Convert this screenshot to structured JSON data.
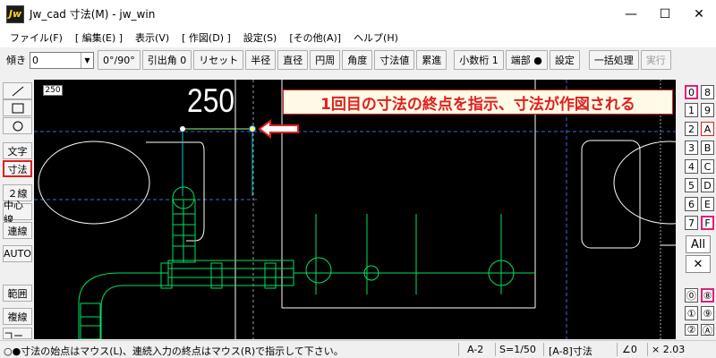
{
  "window": {
    "app_icon": "Jw",
    "title": "Jw_cad 寸法(M) - jw_win",
    "minimize": "—",
    "maximize": "☐",
    "close": "✕"
  },
  "menu": [
    "ファイル(F)",
    "[ 編集(E) ]",
    "表示(V)",
    "[ 作図(D) ]",
    "設定(S)",
    "[その他(A)]",
    "ヘルプ(H)"
  ],
  "toolbar": {
    "tilt_label": "傾き",
    "tilt_value": "0",
    "buttons": {
      "angle": "0°/90°",
      "leader": "引出角 0",
      "reset": "リセット",
      "radius": "半径",
      "diameter": "直径",
      "circumference": "円周",
      "angle_dim": "角度",
      "dim_value": "寸法値",
      "cumulative": "累進",
      "decimal": "小数桁 1",
      "end": "端部 ●",
      "settings": "設定",
      "batch": "一括処理",
      "execute": "実行"
    }
  },
  "left_tools": {
    "line": "line-tool-icon",
    "rect": "rectangle-tool-icon",
    "circle": "circle-tool-icon",
    "text": "文字",
    "dimension": "寸法",
    "double_line": "２線",
    "center_line": "中心線",
    "continuous_line": "連線",
    "auto": "AUTO",
    "range": "範囲",
    "copy_line": "複線",
    "corner": "コーナー"
  },
  "canvas": {
    "scale_tag": "250",
    "dimension_value": "250",
    "annotation": "1回目の寸法の終点を指示、寸法が作図される",
    "colors": {
      "background": "#000000",
      "drawing_white": "#ffffff",
      "drawing_green": "#00e060",
      "dimension_cyan": "#00c8c8",
      "annotation_red": "#e02020"
    }
  },
  "layers": {
    "group_left": [
      "0",
      "1",
      "2",
      "3",
      "4",
      "5",
      "6",
      "7"
    ],
    "group_right": [
      "8",
      "9",
      "A",
      "B",
      "C",
      "D",
      "E",
      "F"
    ],
    "all": "All",
    "cross": "✕",
    "bottom_left": [
      "⓪",
      "①",
      "②"
    ],
    "bottom_right": [
      "⑧",
      "⑨",
      "Ⓐ"
    ]
  },
  "status": {
    "message": "○●寸法の始点はマウス(L)、連続入力の終点はマウス(R)で指示して下さい。",
    "paper": "A-2",
    "scale": "S=1/50",
    "layer": "[A-8]寸法",
    "angle": "∠0",
    "zoom": "× 2.03"
  }
}
